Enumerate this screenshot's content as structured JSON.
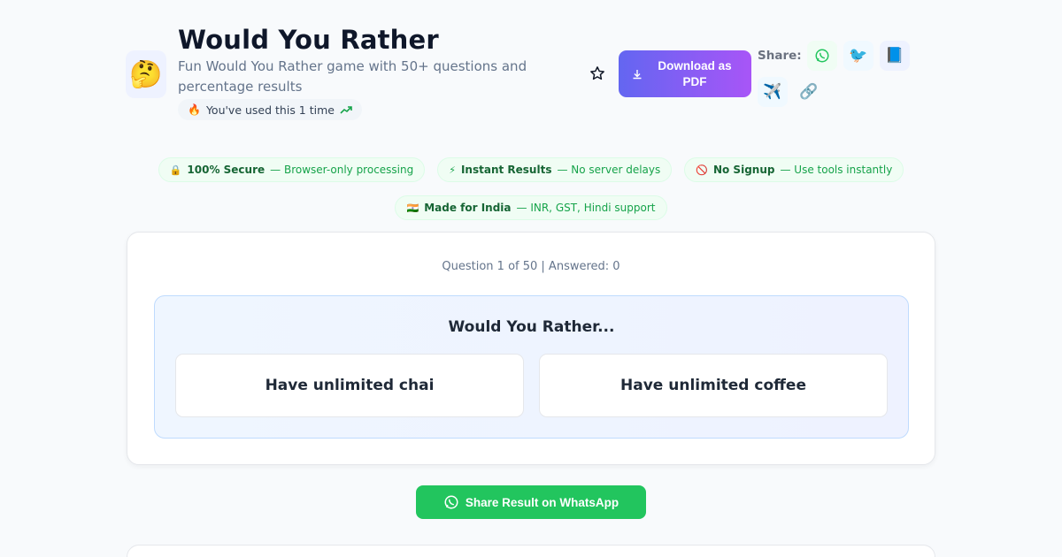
{
  "header": {
    "tool_icon": "🤔",
    "title": "Would You Rather",
    "subtitle": "Fun Would You Rather game with 50+ questions and percentage results",
    "usage": {
      "icon": "🔥",
      "text": "You've used this 1 time",
      "trend_icon": "trend-up-icon"
    },
    "favorite_icon": "star-icon",
    "pdf_button": {
      "label": "Download as PDF",
      "icon": "download-icon"
    },
    "share": {
      "label": "Share:",
      "buttons": [
        {
          "name": "whatsapp",
          "icon": "whatsapp-icon"
        },
        {
          "name": "twitter",
          "icon": "🐦"
        },
        {
          "name": "facebook",
          "icon": "📘"
        },
        {
          "name": "telegram",
          "icon": "✈️"
        },
        {
          "name": "copy-link",
          "icon": "🔗"
        }
      ]
    }
  },
  "badges": [
    {
      "icon": "🔒",
      "title": "100% Secure",
      "desc": "— Browser-only processing"
    },
    {
      "icon": "⚡",
      "title": "Instant Results",
      "desc": "— No server delays"
    },
    {
      "icon": "🚫",
      "title": "No Signup",
      "desc": "— Use tools instantly"
    },
    {
      "icon": "🇮🇳",
      "title": "Made for India",
      "desc": "— INR, GST, Hindi support"
    }
  ],
  "game": {
    "progress": "Question 1 of 50 | Answered: 0",
    "prompt": "Would You Rather...",
    "option_a": "Have unlimited chai",
    "option_b": "Have unlimited coffee"
  },
  "whatsapp_button": {
    "label": "Share Result on WhatsApp",
    "icon": "whatsapp-icon"
  },
  "colors": {
    "accent_gradient_start": "#6366f1",
    "accent_gradient_end": "#a855f7",
    "whatsapp_green": "#22c55e",
    "badge_green": "#16a34a"
  }
}
